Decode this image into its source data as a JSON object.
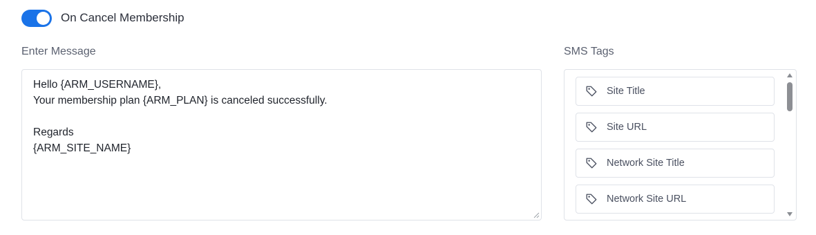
{
  "toggle": {
    "label": "On Cancel Membership",
    "checked": true,
    "color": "#1a73e8"
  },
  "message": {
    "label": "Enter Message",
    "text": "Hello {ARM_USERNAME},\nYour membership plan {ARM_PLAN} is canceled successfully.\n\nRegards\n{ARM_SITE_NAME}"
  },
  "sms_tags": {
    "label": "SMS Tags",
    "items": [
      {
        "label": "Site Title",
        "icon": "tag-icon"
      },
      {
        "label": "Site URL",
        "icon": "tag-icon"
      },
      {
        "label": "Network Site Title",
        "icon": "tag-icon"
      },
      {
        "label": "Network Site URL",
        "icon": "tag-icon"
      }
    ]
  }
}
